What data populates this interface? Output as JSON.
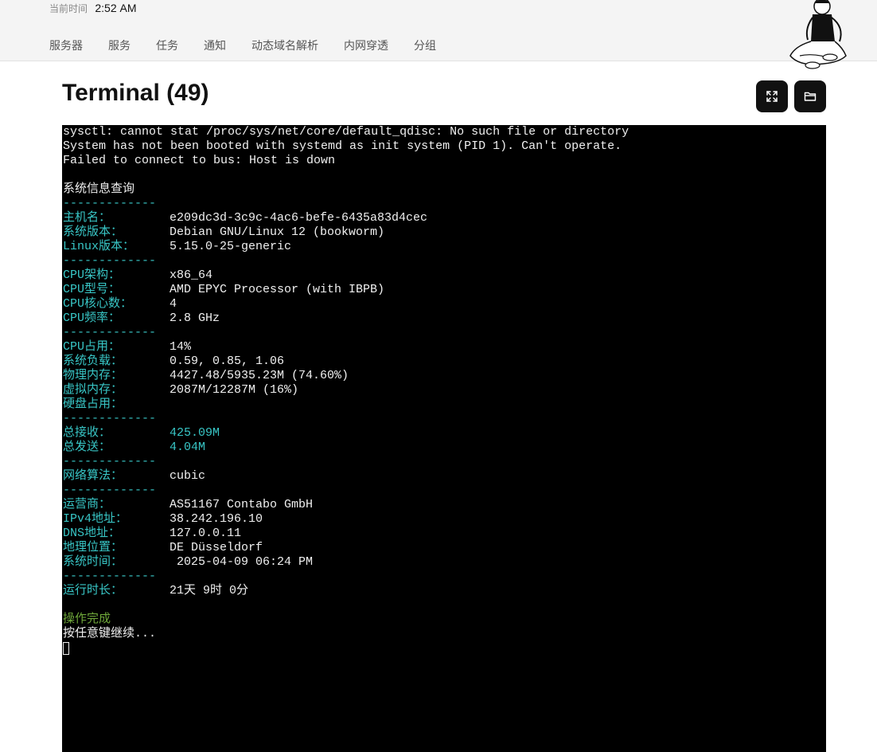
{
  "header": {
    "clock_label": "当前时间",
    "clock_value": "2:52 AM",
    "nav": [
      "服务器",
      "服务",
      "任务",
      "通知",
      "动态域名解析",
      "内网穿透",
      "分组"
    ]
  },
  "page": {
    "title": "Terminal (49)"
  },
  "icons": {
    "fullscreen": "fullscreen-icon",
    "folder": "folder-icon"
  },
  "terminal": {
    "pre_lines": [
      "sysctl: cannot stat /proc/sys/net/core/default_qdisc: No such file or directory",
      "System has not been booted with systemd as init system (PID 1). Can't operate.",
      "Failed to connect to bus: Host is down"
    ],
    "heading": "系统信息查询",
    "separator": "-------------",
    "host": {
      "label": "主机名：",
      "value": "e209dc3d-3c9c-4ac6-befe-6435a83d4cec"
    },
    "os": {
      "label": "系统版本：",
      "value": "Debian GNU/Linux 12 (bookworm)"
    },
    "kernel": {
      "label": "Linux版本：",
      "value": "5.15.0-25-generic"
    },
    "cpu_arch": {
      "label": "CPU架构：",
      "value": "x86_64"
    },
    "cpu_model": {
      "label": "CPU型号：",
      "value": "AMD EPYC Processor (with IBPB)"
    },
    "cpu_cores": {
      "label": "CPU核心数：",
      "value": "4"
    },
    "cpu_freq": {
      "label": "CPU频率：",
      "value": "2.8 GHz"
    },
    "cpu_usage": {
      "label": "CPU占用：",
      "value": "14%"
    },
    "load": {
      "label": "系统负载：",
      "value": "0.59, 0.85, 1.06"
    },
    "mem": {
      "label": "物理内存：",
      "value": "4427.48/5935.23M (74.60%)"
    },
    "swap": {
      "label": "虚拟内存：",
      "value": "2087M/12287M (16%)"
    },
    "disk": {
      "label": "硬盘占用：",
      "value": ""
    },
    "rx": {
      "label": "总接收：",
      "value": "425.09M"
    },
    "tx": {
      "label": "总发送：",
      "value": "4.04M"
    },
    "congestion": {
      "label": "网络算法：",
      "value": "cubic"
    },
    "isp": {
      "label": "运营商：",
      "value": "AS51167 Contabo GmbH"
    },
    "ipv4": {
      "label": "IPv4地址：",
      "value": "38.242.196.10"
    },
    "dns": {
      "label": "DNS地址：",
      "value": "127.0.0.11"
    },
    "geo": {
      "label": "地理位置：",
      "value": "DE Düsseldorf"
    },
    "systime": {
      "label": "系统时间：",
      "value": " 2025-04-09 06:24 PM"
    },
    "uptime": {
      "label": "运行时长：",
      "value": "21天 9时 0分"
    },
    "done": "操作完成",
    "press_key": "按任意键继续..."
  }
}
